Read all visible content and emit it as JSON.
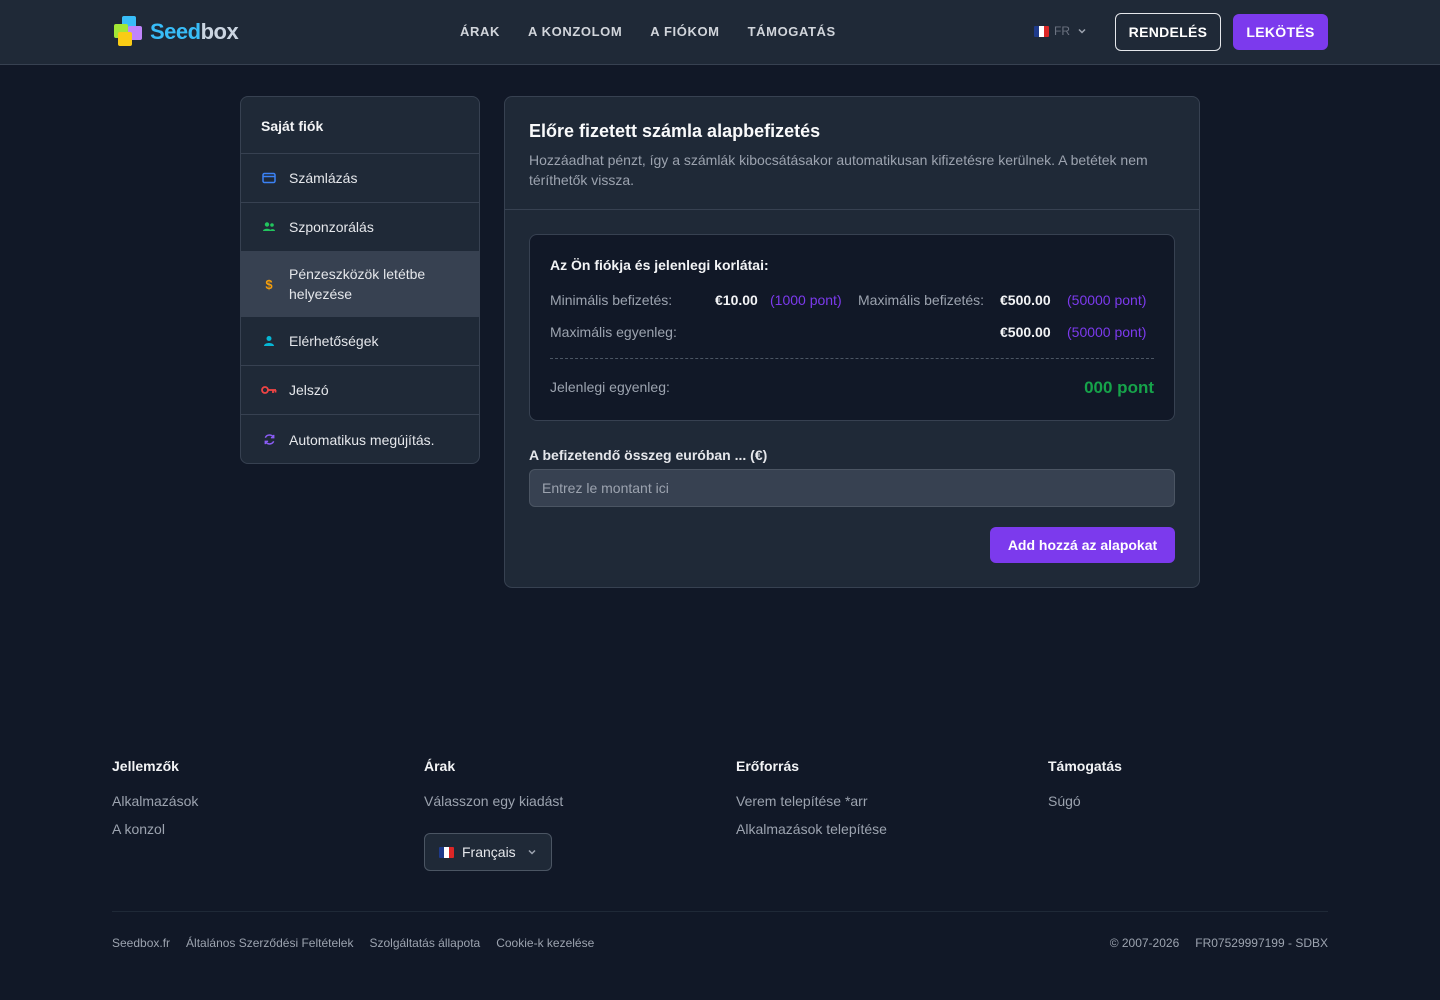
{
  "header": {
    "logo_text_part1": "Seed",
    "logo_text_part2": "box",
    "nav": [
      "ÁRAK",
      "A KONZOLOM",
      "A FIÓKOM",
      "TÁMOGATÁS"
    ],
    "lang": "FR",
    "order_label": "RENDELÉS",
    "login_label": "LEKÖTÉS"
  },
  "sidebar": {
    "title": "Saját fiók",
    "items": [
      {
        "label": "Számlázás",
        "icon": "credit-card-icon",
        "color": "#3b82f6"
      },
      {
        "label": "Szponzorálás",
        "icon": "users-icon",
        "color": "#22c55e"
      },
      {
        "label": "Pénzeszközök letétbe helyezése",
        "icon": "dollar-icon",
        "color": "#f59e0b",
        "active": true
      },
      {
        "label": "Elérhetőségek",
        "icon": "user-icon",
        "color": "#06b6d4"
      },
      {
        "label": "Jelszó",
        "icon": "key-icon",
        "color": "#ef4444"
      },
      {
        "label": "Automatikus megújítás.",
        "icon": "refresh-icon",
        "color": "#8b5cf6"
      }
    ]
  },
  "main": {
    "title": "Előre fizetett számla alapbefizetés",
    "description": "Hozzáadhat pénzt, így a számlák kibocsátásakor automatikusan kifizetésre kerülnek. A betétek nem téríthetők vissza.",
    "limits": {
      "title": "Az Ön fiókja és jelenlegi korlátai:",
      "min_label": "Minimális befizetés:",
      "min_value": "€10.00",
      "min_points": "(1000 pont)",
      "max_label": "Maximális befizetés:",
      "max_value": "€500.00",
      "max_points": "(50000 pont)",
      "max_balance_label": "Maximális egyenleg:",
      "max_balance_value": "€500.00",
      "max_balance_points": "(50000 pont)",
      "current_label": "Jelenlegi egyenleg:",
      "current_value": "000 pont"
    },
    "amount_label": "A befizetendő összeg euróban ... (€)",
    "amount_placeholder": "Entrez le montant ici",
    "submit_label": "Add hozzá az alapokat"
  },
  "footer": {
    "columns": [
      {
        "title": "Jellemzők",
        "links": [
          "Alkalmazások",
          "A konzol"
        ]
      },
      {
        "title": "Árak",
        "links": [
          "Válasszon egy kiadást"
        ]
      },
      {
        "title": "Erőforrás",
        "links": [
          "Verem telepítése *arr",
          "Alkalmazások telepítése"
        ]
      },
      {
        "title": "Támogatás",
        "links": [
          "Súgó"
        ]
      }
    ],
    "language_select": "Français",
    "bottom_links": [
      "Seedbox.fr",
      "Általános Szerződési Feltételek",
      "Szolgáltatás állapota",
      "Cookie-k kezelése"
    ],
    "copyright": "© 2007-2026",
    "company_id": "FR07529997199 - SDBX"
  },
  "colors": {
    "accent": "#7c3aed",
    "success": "#16a34a",
    "background": "#111827",
    "panel": "#1f2937"
  }
}
